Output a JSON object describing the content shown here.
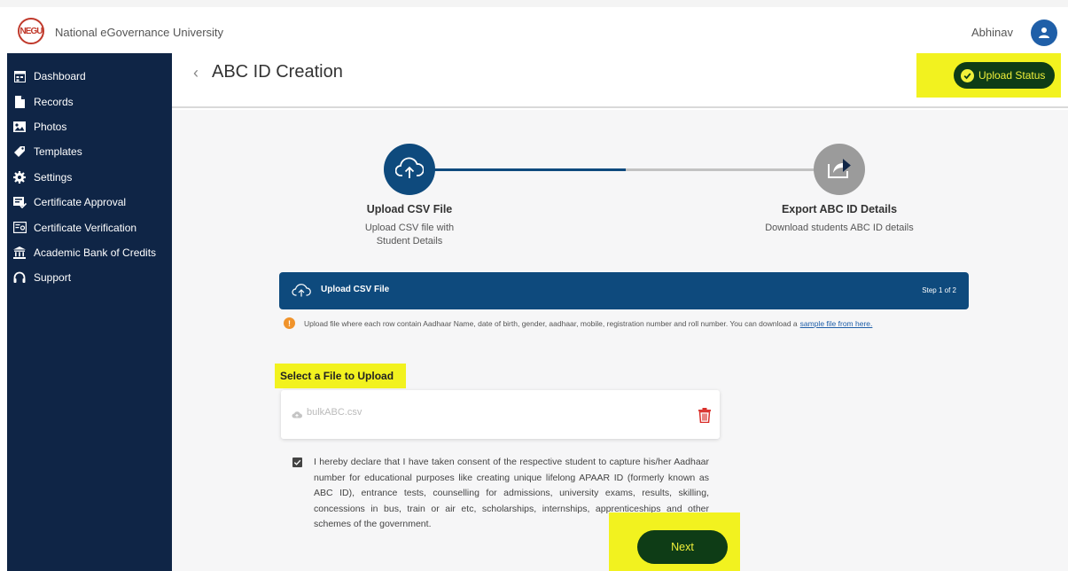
{
  "app": {
    "title": "National eGovernance University",
    "logo_text": "NEGU"
  },
  "user": {
    "name": "Abhinav"
  },
  "sidebar": {
    "items": [
      {
        "label": "Dashboard",
        "icon": "dashboard-icon"
      },
      {
        "label": "Records",
        "icon": "document-icon"
      },
      {
        "label": "Photos",
        "icon": "photos-icon"
      },
      {
        "label": "Templates",
        "icon": "tag-icon"
      },
      {
        "label": "Settings",
        "icon": "gear-icon"
      },
      {
        "label": "Certificate Approval",
        "icon": "certificate-approval-icon"
      },
      {
        "label": "Certificate Verification",
        "icon": "certificate-verification-icon"
      },
      {
        "label": "Academic Bank of Credits",
        "icon": "bank-icon"
      },
      {
        "label": "Support",
        "icon": "headset-icon"
      }
    ]
  },
  "header": {
    "back": "‹",
    "title": "ABC ID Creation",
    "upload_status_label": "Upload Status"
  },
  "steps": [
    {
      "title": "Upload CSV File",
      "desc": "Upload CSV file with\nStudent Details",
      "state": "active",
      "icon": "cloud-upload-icon"
    },
    {
      "title": "Export ABC ID Details",
      "desc": "Download students ABC ID details",
      "state": "pending",
      "icon": "export-icon"
    }
  ],
  "upload_panel": {
    "label": "Upload CSV File",
    "step_text": "Step 1 of 2"
  },
  "info": {
    "text": "Upload file where each row contain Aadhaar Name, date of birth, gender, aadhaar, mobile, registration number and roll number. You can download a",
    "link_text": "sample file from here."
  },
  "file_section": {
    "label": "Select a File to Upload",
    "file_name": "bulkABC.csv"
  },
  "consent": {
    "checked": true,
    "text": "I hereby declare that I have taken consent of the respective student to capture his/her Aadhaar number for educational purposes like creating unique lifelong APAAR ID (formerly known as ABC ID), entrance tests, counselling for admissions, university exams, results, skilling, concessions in bus, train or air etc, scholarships, internships, apprenticeships and other schemes of the government."
  },
  "actions": {
    "next_label": "Next"
  },
  "colors": {
    "sidebar_bg": "#0f2546",
    "primary": "#0e4a7d",
    "button_dark": "#0e3c16",
    "highlight": "#f2f21f",
    "warning": "#f0932b",
    "danger": "#d9302b"
  }
}
